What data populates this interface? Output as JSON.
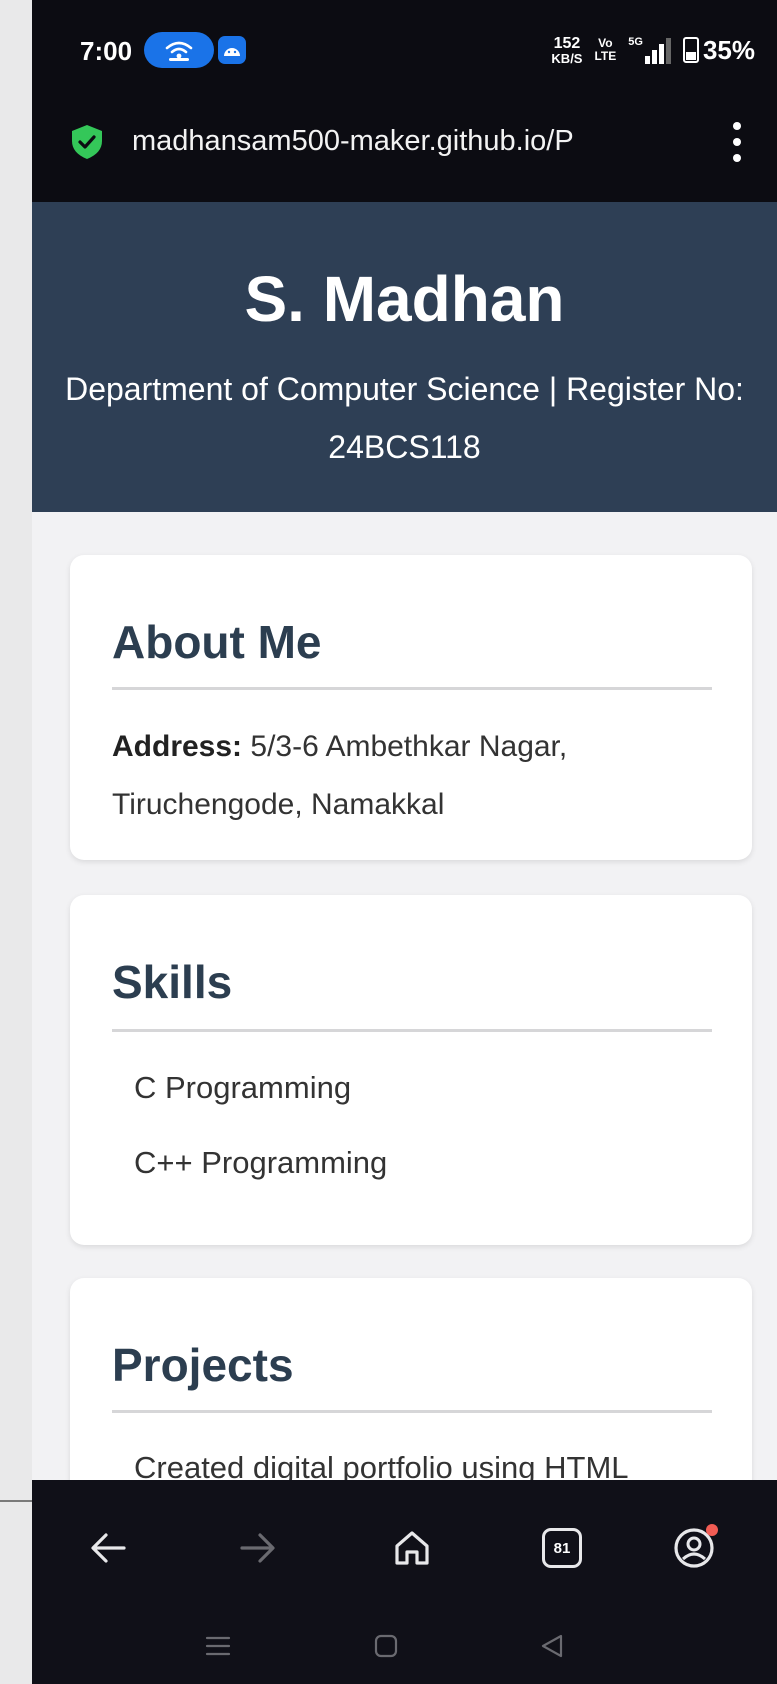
{
  "status_bar": {
    "time": "7:00",
    "net_speed_value": "152",
    "net_speed_unit": "KB/S",
    "volte_top": "Vo",
    "volte_bottom": "LTE",
    "network": "5G",
    "battery": "35%"
  },
  "browser": {
    "url": "madhansam500-maker.github.io/P",
    "tab_count": "81"
  },
  "header": {
    "name": "S. Madhan",
    "subtitle": "Department of Computer Science | Register No: 24BCS118"
  },
  "about": {
    "title": "About Me",
    "address_label": "Address:",
    "address_value": " 5/3-6 Ambethkar Nagar, Tiruchengode, Namakkal"
  },
  "skills": {
    "title": "Skills",
    "items": [
      "C Programming",
      "C++ Programming"
    ]
  },
  "projects": {
    "title": "Projects",
    "items": [
      "Created digital portfolio using HTML"
    ]
  },
  "colors": {
    "header_bg": "#2e3f55",
    "heading_text": "#2c3e50",
    "accent_blue": "#1a73e8",
    "shield_green": "#34c759"
  }
}
